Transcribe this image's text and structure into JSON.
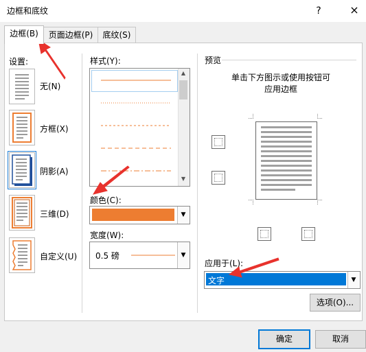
{
  "dialog": {
    "title": "边框和底纹",
    "help": "?",
    "close": "×"
  },
  "tabs": [
    {
      "label": "边框(B)",
      "active": true
    },
    {
      "label": "页面边框(P)",
      "active": false
    },
    {
      "label": "底纹(S)",
      "active": false
    }
  ],
  "settings": {
    "heading": "设置:",
    "items": [
      {
        "label": "无(N)"
      },
      {
        "label": "方框(X)"
      },
      {
        "label": "阴影(A)"
      },
      {
        "label": "三维(D)"
      },
      {
        "label": "自定义(U)"
      }
    ]
  },
  "style": {
    "heading": "样式(Y):"
  },
  "color": {
    "heading": "颜色(C):",
    "value_hex": "#ed7d31"
  },
  "width": {
    "heading": "宽度(W):",
    "value": "0.5 磅"
  },
  "preview": {
    "heading": "预览",
    "hint_line1": "单击下方图示或使用按钮可",
    "hint_line2": "应用边框"
  },
  "apply_to": {
    "heading": "应用于(L):",
    "value": "文字"
  },
  "buttons": {
    "options": "选项(O)...",
    "ok": "确定",
    "cancel": "取消"
  },
  "colors": {
    "accent_orange": "#ed7d31",
    "selection_blue": "#0078d7",
    "annotation_red": "#e8322d"
  }
}
